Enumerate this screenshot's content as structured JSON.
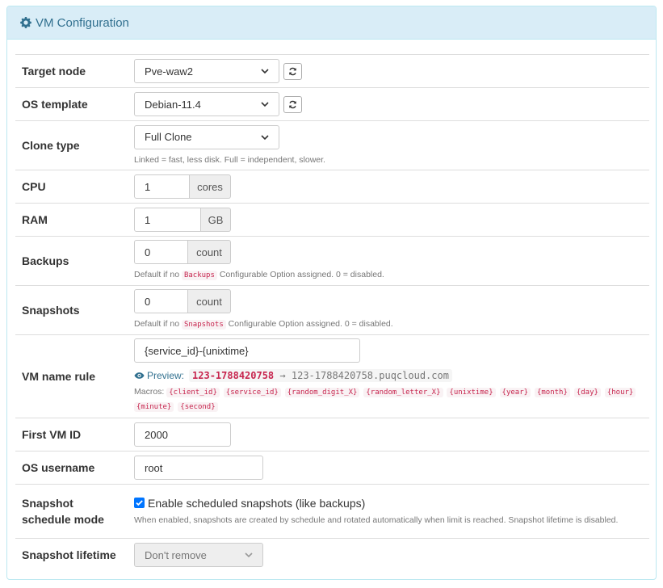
{
  "panel": {
    "title": "VM Configuration"
  },
  "rows": {
    "target_node": {
      "label": "Target node",
      "value": "Pve-waw2"
    },
    "os_template": {
      "label": "OS template",
      "value": "Debian-11.4"
    },
    "clone_type": {
      "label": "Clone type",
      "value": "Full Clone",
      "help": "Linked = fast, less disk. Full = independent, slower."
    },
    "cpu": {
      "label": "CPU",
      "value": "1",
      "unit": "cores"
    },
    "ram": {
      "label": "RAM",
      "value": "1",
      "unit": "GB"
    },
    "backups": {
      "label": "Backups",
      "value": "0",
      "unit": "count",
      "help_pre": "Default if no",
      "help_code": "Backups",
      "help_post": "Configurable Option assigned. 0 = disabled."
    },
    "snapshots": {
      "label": "Snapshots",
      "value": "0",
      "unit": "count",
      "help_pre": "Default if no",
      "help_code": "Snapshots",
      "help_post": "Configurable Option assigned. 0 = disabled."
    },
    "vm_name_rule": {
      "label": "VM name rule",
      "value": "{service_id}-{unixtime}",
      "preview_label": "Preview:",
      "preview_name": "123-1788420758",
      "preview_arrow": "→",
      "preview_fqdn": "123-1788420758.puqcloud.com",
      "macros_label": "Macros:",
      "macros": [
        "{client_id}",
        "{service_id}",
        "{random_digit_X}",
        "{random_letter_X}",
        "{unixtime}",
        "{year}",
        "{month}",
        "{day}",
        "{hour}",
        "{minute}",
        "{second}"
      ]
    },
    "first_vm_id": {
      "label": "First VM ID",
      "value": "2000"
    },
    "os_username": {
      "label": "OS username",
      "value": "root"
    },
    "snapshot_schedule_mode": {
      "label_line1": "Snapshot",
      "label_line2": "schedule mode",
      "checkbox_label": "Enable scheduled snapshots (like backups)",
      "checked": true,
      "help": "When enabled, snapshots are created by schedule and rotated automatically when limit is reached. Snapshot lifetime is disabled."
    },
    "snapshot_lifetime": {
      "label": "Snapshot lifetime",
      "value": "Don't remove",
      "disabled": true
    }
  },
  "icons": {
    "heading": "gear-icon",
    "refresh": "refresh-icon",
    "preview": "eye-icon",
    "select": "chevron-down-icon",
    "checkbox": "checkmark-icon"
  },
  "colors": {
    "heading_bg": "#d9edf7",
    "heading_text": "#31708f",
    "code_text": "#c7254e",
    "checkbox": "#0075ff"
  }
}
